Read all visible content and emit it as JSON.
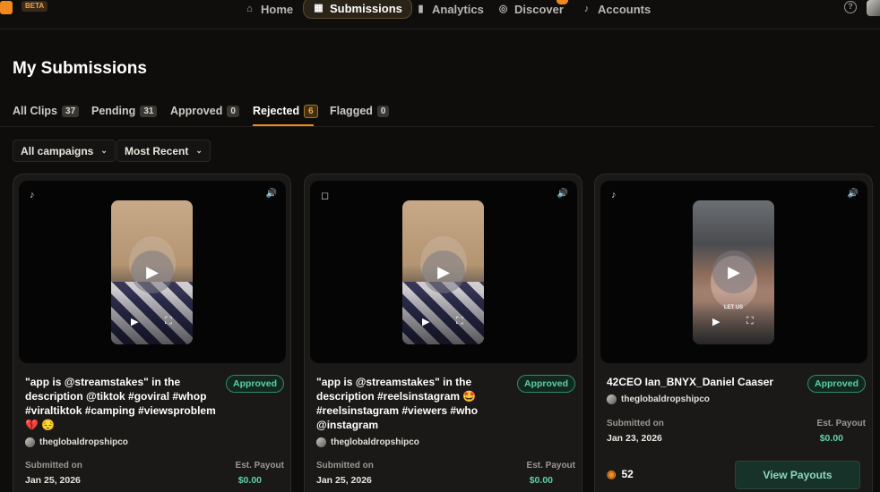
{
  "app": {
    "beta_label": "BETA"
  },
  "nav": [
    {
      "label": "Home",
      "icon": "home-icon"
    },
    {
      "label": "Submissions",
      "icon": "grid-icon",
      "active": true
    },
    {
      "label": "Analytics",
      "icon": "bar-chart-icon"
    },
    {
      "label": "Discover",
      "icon": "compass-icon"
    },
    {
      "label": "Accounts",
      "icon": "tiktok-icon"
    }
  ],
  "page": {
    "title": "My Submissions"
  },
  "tabs": [
    {
      "label": "All Clips",
      "count": "37"
    },
    {
      "label": "Pending",
      "count": "31"
    },
    {
      "label": "Approved",
      "count": "0"
    },
    {
      "label": "Rejected",
      "count": "6",
      "active": true
    },
    {
      "label": "Flagged",
      "count": "0"
    }
  ],
  "filters": {
    "campaign": "All campaigns",
    "sort": "Most Recent"
  },
  "cards": [
    {
      "platform": "tiktok-icon",
      "title": "\"app is @streamstakes\" in the description @tiktok #goviral #whop #viraltiktok #camping #viewsproblem",
      "title_emoji": "💔 😔",
      "status": "Approved",
      "creator": "theglobaldropshipco",
      "submitted_label": "Submitted on",
      "submitted_date": "Jan 25, 2026",
      "payout_label": "Est. Payout",
      "payout_value": "$0.00"
    },
    {
      "platform": "instagram-icon",
      "title": "\"app is @streamstakes\" in the description #reelsinstagram 🤩 #reelsinstagram #viewers #who @instagram",
      "status": "Approved",
      "creator": "theglobaldropshipco",
      "submitted_label": "Submitted on",
      "submitted_date": "Jan 25, 2026",
      "payout_label": "Est. Payout",
      "payout_value": "$0.00"
    },
    {
      "platform": "tiktok-icon",
      "title": "42CEO Ian_BNYX_Daniel Caaser",
      "status": "Approved",
      "creator": "theglobaldropshipco",
      "thumb_caption": "LET US",
      "submitted_label": "Submitted on",
      "submitted_date": "Jan 23, 2026",
      "payout_label": "Est. Payout",
      "payout_value": "$0.00",
      "views": "52",
      "action_label": "View Payouts"
    }
  ],
  "colors": {
    "accent": "#f08a1c",
    "approved": "#5fd0a6",
    "background": "#0e0d0c"
  }
}
